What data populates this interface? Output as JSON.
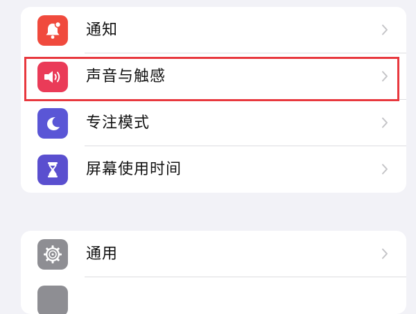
{
  "colors": {
    "background": "#f2f2f7",
    "highlight": "#e8383e",
    "notifications_icon_bg": "#f04a3d",
    "sounds_icon_bg": "#ea3b58",
    "focus_icon_bg": "#5a56d6",
    "screentime_icon_bg": "#5a4fcf",
    "general_icon_bg": "#8e8e93"
  },
  "settings": {
    "group1": [
      {
        "label": "通知",
        "icon": "bell-icon"
      },
      {
        "label": "声音与触感",
        "icon": "speaker-icon"
      },
      {
        "label": "专注模式",
        "icon": "moon-icon"
      },
      {
        "label": "屏幕使用时间",
        "icon": "hourglass-icon"
      }
    ],
    "group2": [
      {
        "label": "通用",
        "icon": "gear-icon"
      },
      {
        "label": "",
        "icon": "control-center-icon"
      }
    ]
  },
  "highlighted_item": "声音与触感"
}
